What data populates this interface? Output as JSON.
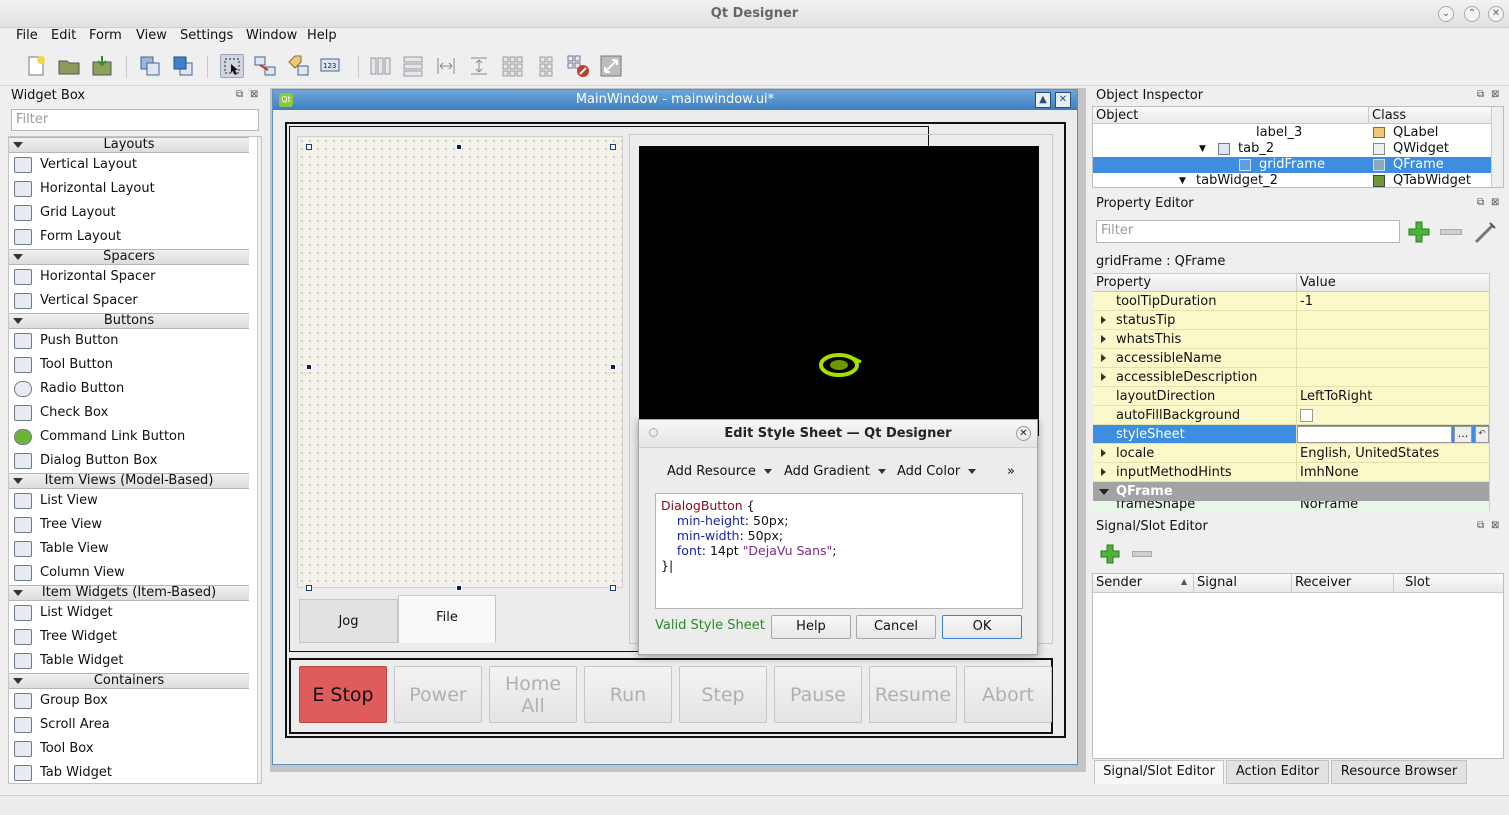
{
  "window": {
    "title": "Qt Designer",
    "min": "⌄",
    "max": "⌃",
    "close": "✕"
  },
  "menu": [
    "File",
    "Edit",
    "Form",
    "View",
    "Settings",
    "Window",
    "Help"
  ],
  "toolbar_icons": [
    "new-form-icon",
    "open-form-icon",
    "save-form-icon",
    "send-to-back-icon",
    "bring-to-front-icon",
    "edit-widgets-icon",
    "edit-signals-slots-icon",
    "edit-buddies-icon",
    "edit-tab-order-icon",
    "layout-horizontal-icon",
    "layout-vertical-icon",
    "layout-horizontal-splitter-icon",
    "layout-vertical-splitter-icon",
    "layout-grid-icon",
    "layout-form-icon",
    "break-layout-icon",
    "adjust-size-icon"
  ],
  "widget_box": {
    "title": "Widget Box",
    "filter_placeholder": "Filter",
    "categories": [
      {
        "name": "Layouts",
        "items": [
          "Vertical Layout",
          "Horizontal Layout",
          "Grid Layout",
          "Form Layout"
        ]
      },
      {
        "name": "Spacers",
        "items": [
          "Horizontal Spacer",
          "Vertical Spacer"
        ]
      },
      {
        "name": "Buttons",
        "items": [
          "Push Button",
          "Tool Button",
          "Radio Button",
          "Check Box",
          "Command Link Button",
          "Dialog Button Box"
        ]
      },
      {
        "name": "Item Views (Model-Based)",
        "items": [
          "List View",
          "Tree View",
          "Table View",
          "Column View"
        ]
      },
      {
        "name": "Item Widgets (Item-Based)",
        "items": [
          "List Widget",
          "Tree Widget",
          "Table Widget"
        ]
      },
      {
        "name": "Containers",
        "items": [
          "Group Box",
          "Scroll Area",
          "Tool Box",
          "Tab Widget"
        ]
      }
    ]
  },
  "subwindow": {
    "title": "MainWindow - mainwindow.ui*",
    "icon": "Qt"
  },
  "form": {
    "tabs": [
      "Jog",
      "File"
    ],
    "controls": [
      "E Stop",
      "Power",
      "Home\nAll",
      "Run",
      "Step",
      "Pause",
      "Resume",
      "Abort"
    ],
    "estop_color": "#e05b5b"
  },
  "dialog": {
    "title": "Edit Style Sheet — Qt Designer",
    "menus": [
      "Add Resource",
      "Add Gradient",
      "Add Color"
    ],
    "more": "»",
    "code_selector": "DialogButton",
    "code_props": [
      {
        "prop": "min-height",
        "value": "50px;"
      },
      {
        "prop": "min-width",
        "value": "50px;"
      },
      {
        "prop": "font",
        "value": "14pt ",
        "str": "\"DejaVu Sans\"",
        "end": ";"
      }
    ],
    "code_open": " {",
    "code_close": "}",
    "status": "Valid Style Sheet",
    "buttons": [
      "Help",
      "Cancel",
      "OK"
    ]
  },
  "object_inspector": {
    "title": "Object Inspector",
    "columns": [
      "Object",
      "Class"
    ],
    "rows": [
      {
        "object": "label_3",
        "class": "QLabel"
      },
      {
        "object": "tab_2",
        "class": "QWidget"
      },
      {
        "object": "gridFrame",
        "class": "QFrame"
      },
      {
        "object": "tabWidget_2",
        "class": "QTabWidget"
      }
    ]
  },
  "property_editor": {
    "title": "Property Editor",
    "filter_placeholder": "Filter",
    "context": "gridFrame : QFrame",
    "columns": [
      "Property",
      "Value"
    ],
    "rows": [
      {
        "name": "toolTipDuration",
        "value": "-1",
        "expand": false
      },
      {
        "name": "statusTip",
        "value": "",
        "expand": true
      },
      {
        "name": "whatsThis",
        "value": "",
        "expand": true
      },
      {
        "name": "accessibleName",
        "value": "",
        "expand": true
      },
      {
        "name": "accessibleDescription",
        "value": "",
        "expand": true
      },
      {
        "name": "layoutDirection",
        "value": "LeftToRight",
        "expand": false
      },
      {
        "name": "autoFillBackground",
        "value": "",
        "expand": false
      },
      {
        "name": "styleSheet",
        "value": "",
        "expand": false
      },
      {
        "name": "locale",
        "value": "English, UnitedStates",
        "expand": true
      },
      {
        "name": "inputMethodHints",
        "value": "ImhNone",
        "expand": true
      }
    ],
    "group": "QFrame",
    "partial_row": {
      "name": "frameShape",
      "value": "NoFrame"
    },
    "ellipsis": "..."
  },
  "signal_slot": {
    "title": "Signal/Slot Editor",
    "columns": [
      "Sender",
      "Signal",
      "Receiver",
      "Slot"
    ]
  },
  "bottom_tabs": [
    "Signal/Slot Editor",
    "Action Editor",
    "Resource Browser"
  ]
}
